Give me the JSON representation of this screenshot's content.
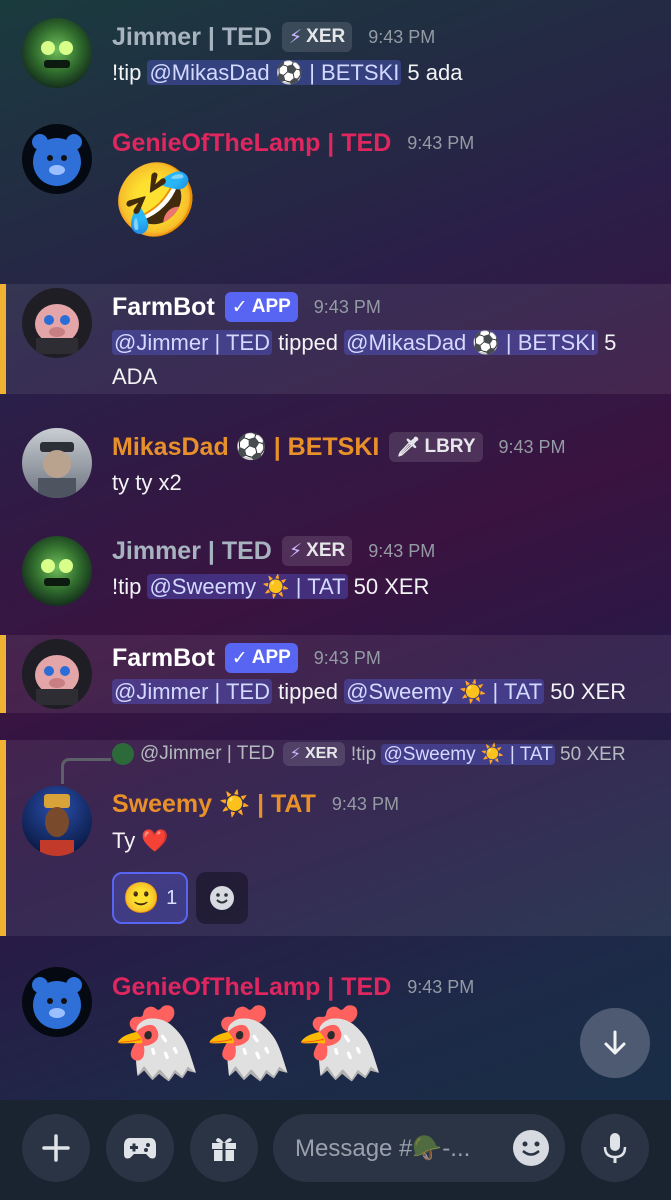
{
  "colors": {
    "mention_bg": "#5865f2",
    "name_green": "#a8b3c0",
    "name_pink": "#e0265f",
    "name_orange": "#e8902a",
    "highlight_bar": "#f0b232"
  },
  "messages": [
    {
      "author": "Jimmer | TED",
      "tag_icon": "⚡",
      "tag": "XER",
      "time": "9:43 PM",
      "text_prefix": "!tip ",
      "mention": "@MikasDad ⚽ | BETSKI",
      "text_suffix": " 5 ada"
    },
    {
      "author": "GenieOfTheLamp | TED",
      "time": "9:43 PM",
      "emoji": "🤣"
    },
    {
      "author": "FarmBot",
      "tag_icon": "✓",
      "tag": "APP",
      "time": "9:43 PM",
      "mention1": "@Jimmer | TED",
      "middle": " tipped ",
      "mention2": "@MikasDad ⚽ | BETSKI",
      "text_suffix": " 5 ADA"
    },
    {
      "author": "MikasDad ⚽ | BETSKI",
      "tag_icon": "🗡",
      "tag": "LBRY",
      "time": "9:43 PM",
      "text": "ty ty x2"
    },
    {
      "author": "Jimmer | TED",
      "tag_icon": "⚡",
      "tag": "XER",
      "time": "9:43 PM",
      "text_prefix": "!tip ",
      "mention": "@Sweemy ☀️ | TAT",
      "text_suffix": " 50 XER"
    },
    {
      "author": "FarmBot",
      "tag_icon": "✓",
      "tag": "APP",
      "time": "9:43 PM",
      "mention1": "@Jimmer | TED",
      "middle": " tipped ",
      "mention2": "@Sweemy ☀️ | TAT",
      "text_suffix": " 50 XER"
    },
    {
      "reply": {
        "author": "@Jimmer | TED",
        "tag_icon": "⚡",
        "tag": "XER",
        "text_prefix": "!tip ",
        "mention": "@Sweemy ☀️ | TAT",
        "text_suffix": " 50 XER"
      },
      "author": "Sweemy ☀️ | TAT",
      "time": "9:43 PM",
      "text": "Ty ❤️",
      "reaction_emoji": "🙂",
      "reaction_count": "1"
    },
    {
      "author": "GenieOfTheLamp | TED",
      "time": "9:43 PM",
      "emoji": "🐔🐔🐔"
    }
  ],
  "composer": {
    "placeholder": "Message #🪖-..."
  },
  "icons": {
    "add": "plus-icon",
    "apps": "gamepad-icon",
    "gift": "gift-icon",
    "emoji": "smiley-icon",
    "voice": "microphone-icon",
    "jump": "arrow-down-icon"
  }
}
